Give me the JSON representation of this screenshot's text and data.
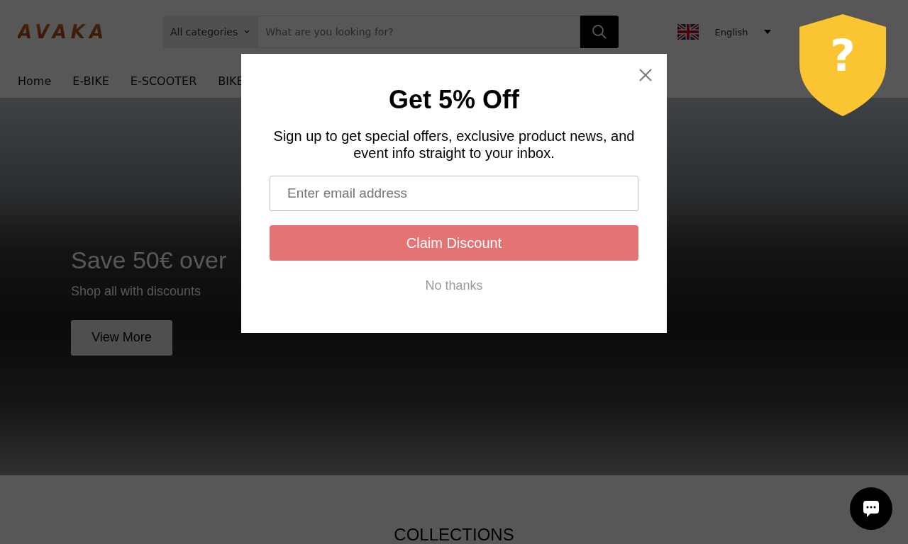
{
  "header": {
    "logo": "AVAKA",
    "category_select": "All categories",
    "search": {
      "placeholder": "What are you looking for?"
    },
    "language": "English"
  },
  "nav": {
    "items": [
      {
        "label": "Home"
      },
      {
        "label": "E-BIKE"
      },
      {
        "label": "E-SCOOTER"
      },
      {
        "label": "BIKE"
      }
    ]
  },
  "hero": {
    "title": "Save 50€ over",
    "subtitle": "Shop all with discounts",
    "button": "View More"
  },
  "section_title": "COLLECTIONS",
  "popup": {
    "title": "Get 5% Off",
    "text": "Sign up to get special offers, exclusive product news, and event info straight to your inbox.",
    "email": {
      "placeholder": "Enter email address"
    },
    "submit": "Claim Discount",
    "decline": "No thanks"
  },
  "trust_badge": {
    "symbol": "?"
  }
}
